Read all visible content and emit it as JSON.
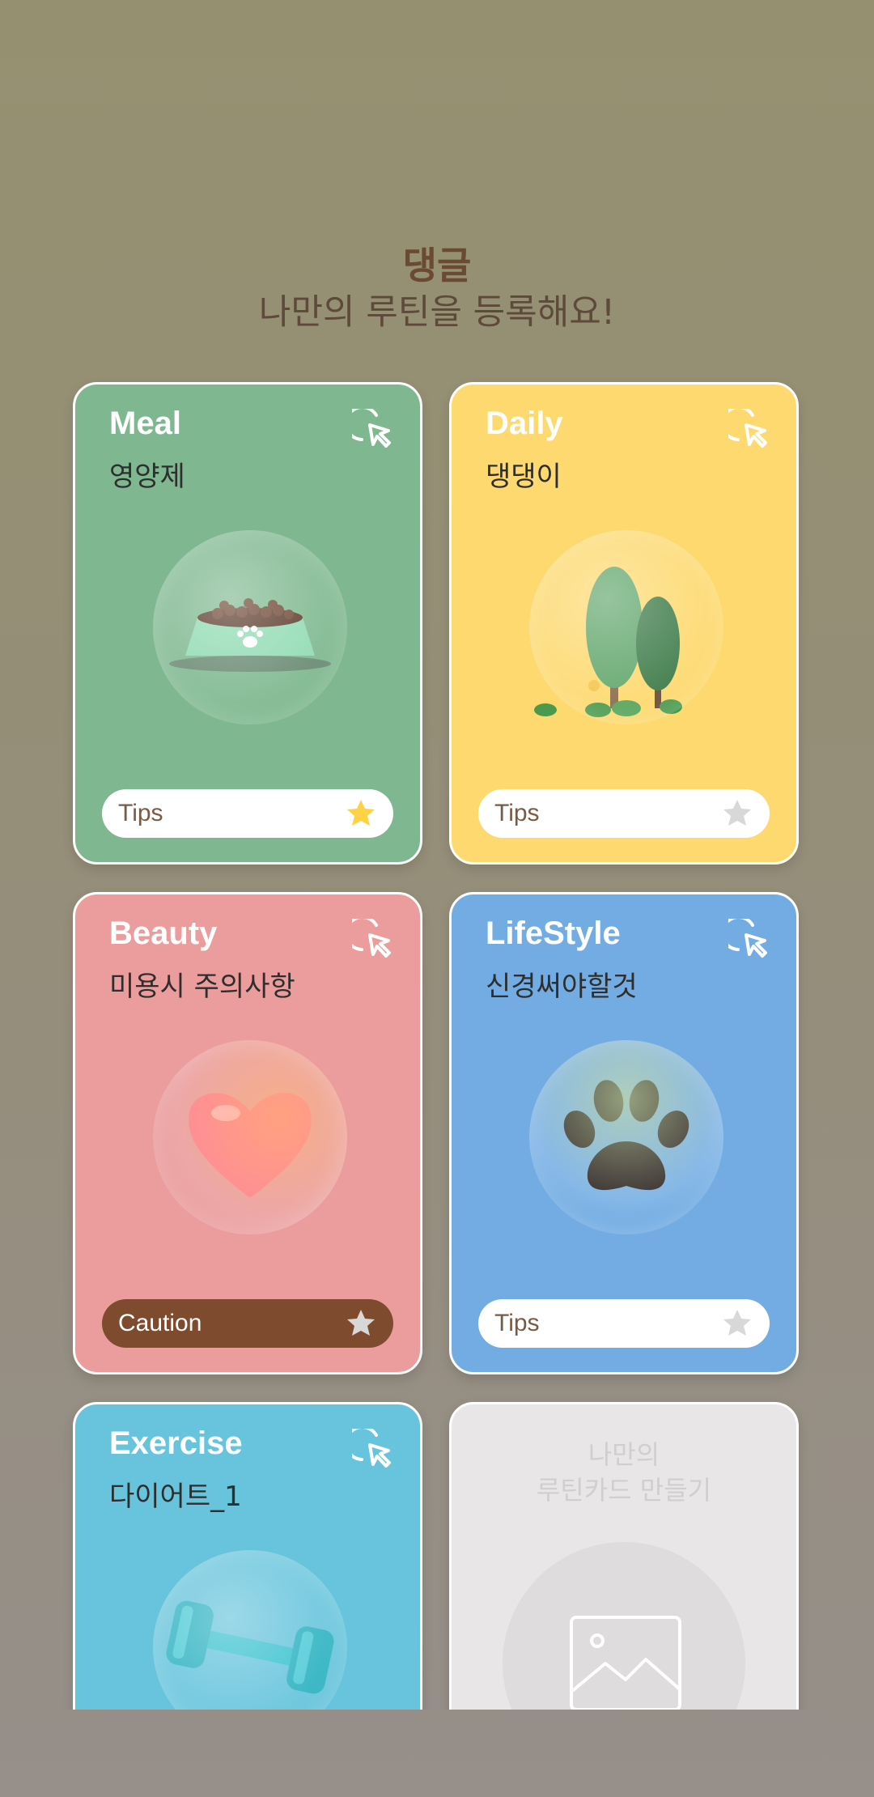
{
  "header": {
    "brand": "댕글",
    "subtitle": "나만의 루틴을 등록해요!"
  },
  "cards": [
    {
      "title": "Meal",
      "subtitle": "영양제",
      "pill_label": "Tips",
      "favorited": true,
      "color": "#7fb890",
      "art": "dog-food-bowl"
    },
    {
      "title": "Daily",
      "subtitle": "댕댕이",
      "pill_label": "Tips",
      "favorited": false,
      "color": "#fdd96f",
      "art": "trees"
    },
    {
      "title": "Beauty",
      "subtitle": "미용시 주의사항",
      "pill_label": "Caution",
      "favorited": false,
      "color": "#eb9d9d",
      "art": "heart"
    },
    {
      "title": "LifeStyle",
      "subtitle": "신경써야할것",
      "pill_label": "Tips",
      "favorited": false,
      "color": "#72ace3",
      "art": "paw-print"
    },
    {
      "title": "Exercise",
      "subtitle": "다이어트_1",
      "color": "#67c4dc",
      "art": "dumbbell"
    }
  ],
  "make_card": {
    "title": "나만의\n루틴카드 만들기",
    "icon": "image-placeholder-icon"
  },
  "colors": {
    "star_active": "#fdd244",
    "star_inactive": "#d8d8d8",
    "caution_pill": "#7f4b2e"
  },
  "icons": {
    "tap": "tap-cursor-icon",
    "star": "star-icon"
  }
}
